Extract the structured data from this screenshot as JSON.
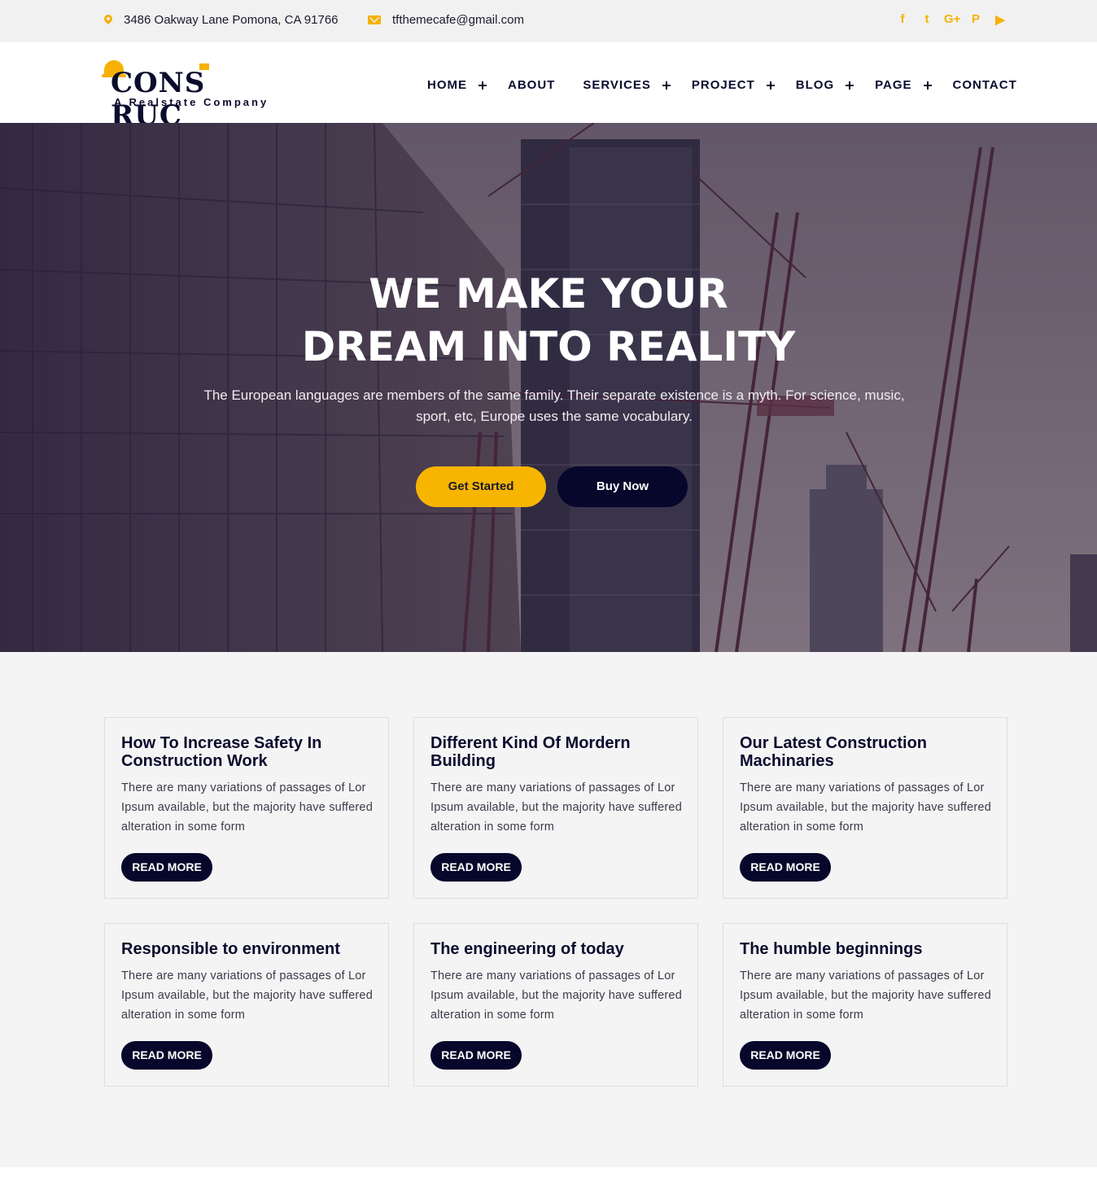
{
  "topbar": {
    "address": "3486 Oakway Lane Pomona, CA 91766",
    "email": "tfthemecafe@gmail.com",
    "social": [
      {
        "icon": "facebook-icon",
        "glyph": "f"
      },
      {
        "icon": "twitter-icon",
        "glyph": "t"
      },
      {
        "icon": "google-plus-icon",
        "glyph": "G+"
      },
      {
        "icon": "pinterest-icon",
        "glyph": "P"
      },
      {
        "icon": "youtube-icon",
        "glyph": "▶"
      }
    ]
  },
  "logo": {
    "word": "CONS RUC",
    "tagline": "A Realstate Company"
  },
  "nav": [
    {
      "label": "HOME",
      "has_sub": true
    },
    {
      "label": "ABOUT",
      "has_sub": false
    },
    {
      "label": "SERVICES",
      "has_sub": true
    },
    {
      "label": "PROJECT",
      "has_sub": true
    },
    {
      "label": "BLOG",
      "has_sub": true
    },
    {
      "label": "PAGE",
      "has_sub": true
    },
    {
      "label": "CONTACT",
      "has_sub": false
    }
  ],
  "hero": {
    "title_line1": "WE MAKE YOUR",
    "title_line2": "DREAM INTO REALITY",
    "subtitle": "The European languages are members of the same family. Their separate existence is a myth. For science, music, sport, etc, Europe uses the same vocabulary.",
    "primary_button": "Get Started",
    "secondary_button": "Buy Now"
  },
  "cards": [
    {
      "title": "How To Increase Safety In Construction Work",
      "text": "There are many variations of passages of Lor Ipsum available, but the majority have suffered alteration in some form",
      "button": "READ MORE"
    },
    {
      "title": "Different Kind Of Mordern Building",
      "text": "There are many variations of passages of Lor Ipsum available, but the majority have suffered alteration in some form",
      "button": "READ MORE"
    },
    {
      "title": "Our Latest Construction Machinaries",
      "text": "There are many variations of passages of Lor Ipsum available, but the majority have suffered alteration in some form",
      "button": "READ MORE"
    },
    {
      "title": "Responsible to environment",
      "text": "There are many variations of passages of Lor Ipsum available, but the majority have suffered alteration in some form",
      "button": "READ MORE"
    },
    {
      "title": "The engineering of today",
      "text": "There are many variations of passages of Lor Ipsum available, but the majority have suffered alteration in some form",
      "button": "READ MORE"
    },
    {
      "title": "The humble beginnings",
      "text": "There are many variations of passages of Lor Ipsum available, but the majority have suffered alteration in some form",
      "button": "READ MORE"
    }
  ],
  "colors": {
    "accent": "#f7b500",
    "navy": "#07072b",
    "topbar_bg": "#f1f1f1",
    "section_bg": "#f4f4f4"
  }
}
